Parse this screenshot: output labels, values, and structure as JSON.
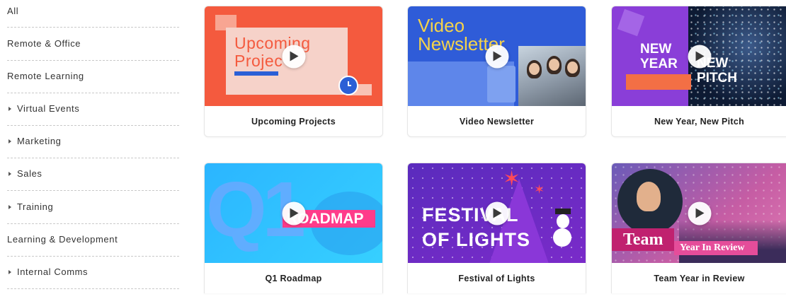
{
  "sidebar": {
    "items": [
      {
        "label": "All",
        "has_caret": false
      },
      {
        "label": "Remote & Office",
        "has_caret": false
      },
      {
        "label": "Remote Learning",
        "has_caret": false
      },
      {
        "label": "Virtual Events",
        "has_caret": true
      },
      {
        "label": "Marketing",
        "has_caret": true
      },
      {
        "label": "Sales",
        "has_caret": true
      },
      {
        "label": "Training",
        "has_caret": true
      },
      {
        "label": "Learning & Development",
        "has_caret": false
      },
      {
        "label": "Internal Comms",
        "has_caret": true
      }
    ]
  },
  "templates": [
    {
      "title": "Upcoming Projects",
      "thumb_text": [
        "Upcoming",
        "Projec"
      ],
      "accent": "#f45a3e"
    },
    {
      "title": "Video Newsletter",
      "thumb_text": [
        "Video",
        "Newsletter"
      ],
      "accent": "#2f5cd8"
    },
    {
      "title": "New Year, New Pitch",
      "thumb_text": [
        "NEW",
        "YEAR",
        "NEW",
        "PITCH"
      ],
      "accent": "#8a3ed8"
    },
    {
      "title": "Q1 Roadmap",
      "thumb_text": [
        "Q1",
        "ROADMAP"
      ],
      "accent": "#2bb5ff"
    },
    {
      "title": "Festival of Lights",
      "thumb_text": [
        "FESTIVAL",
        "OF LIGHTS"
      ],
      "accent": "#5a2bbd"
    },
    {
      "title": "Team Year in Review",
      "thumb_text": [
        "Team",
        "Year In Review"
      ],
      "accent": "#c0216f"
    }
  ],
  "icons": {
    "play": "play-icon",
    "caret": "caret-right-icon",
    "clock": "clock-icon"
  }
}
